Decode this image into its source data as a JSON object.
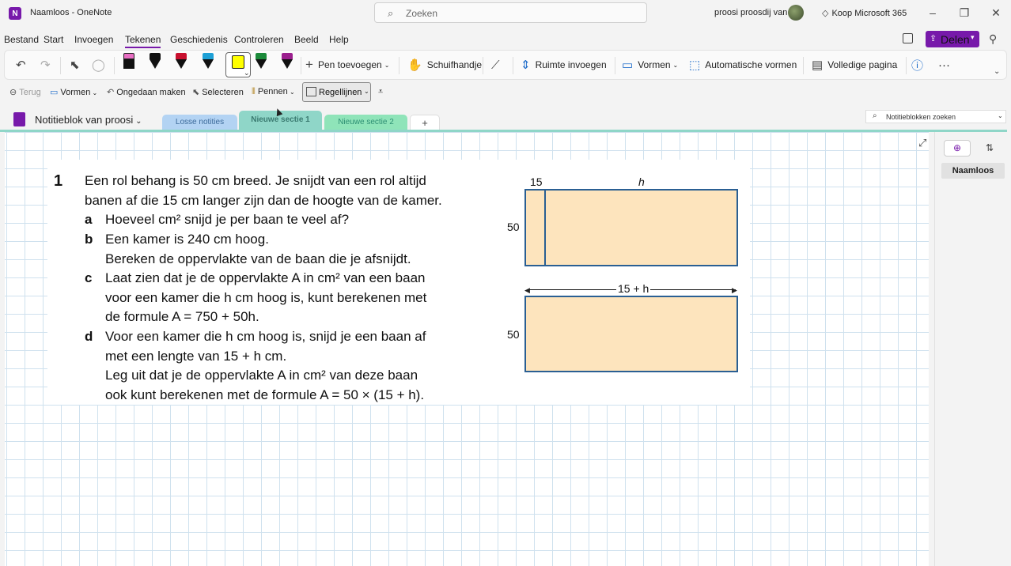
{
  "window": {
    "title": "Naamloos  -  OneNote",
    "search_placeholder": "Zoeken",
    "user_name": "proosi proosdij van",
    "koop_label": "Koop Microsoft 365",
    "app_logo": "N"
  },
  "menu": [
    "Bestand",
    "Start",
    "Invoegen",
    "Tekenen",
    "Geschiedenis",
    "Controleren",
    "Beeld",
    "Help"
  ],
  "share_label": "Delen",
  "ribbon": {
    "pen_add": "Pen toevoegen",
    "hand": "Schuifhandje",
    "space": "Ruimte invoegen",
    "shapes": "Vormen",
    "auto_shapes": "Automatische vormen",
    "full_page": "Volledige pagina",
    "more": "···"
  },
  "qat": {
    "back": "Terug",
    "shapes": "Vormen",
    "undo": "Ongedaan maken",
    "select": "Selecteren",
    "pens": "Pennen",
    "rule_lines": "Regellijnen"
  },
  "notebook": {
    "name": "Notitieblok van proosi",
    "tabs": [
      "Losse notities",
      "Nieuwe sectie 1",
      "Nieuwe sectie 2"
    ],
    "add_tab": "+",
    "search_placeholder": "Notitieblokken zoeken"
  },
  "pages": [
    "Naamloos"
  ],
  "exercise": {
    "number": "1",
    "lines": [
      "Een rol behang is 50 cm breed. Je snijdt van een rol altijd",
      "banen af die 15 cm langer zijn dan de hoogte van de kamer.",
      "Hoeveel cm² snijd je per baan te veel af?",
      "Een kamer is 240 cm hoog.",
      "Bereken de oppervlakte van de baan die je afsnijdt.",
      "Laat zien dat je de oppervlakte A in cm² van een baan",
      "voor een kamer die h cm hoog is, kunt berekenen met",
      "de formule A = 750 + 50h.",
      "Voor een kamer die h cm hoog is, snijd je een baan af",
      "met een lengte van 15 + h cm.",
      "Leg uit dat je de oppervlakte A in cm² van deze baan",
      "ook kunt berekenen met de formule A = 50 × (15 + h)."
    ],
    "letters": [
      "a",
      "b",
      "c",
      "d"
    ],
    "figure": {
      "top_label_15": "15",
      "top_label_h": "h",
      "side_label_1": "50",
      "arrow_label": "15 + h",
      "side_label_2": "50"
    }
  }
}
